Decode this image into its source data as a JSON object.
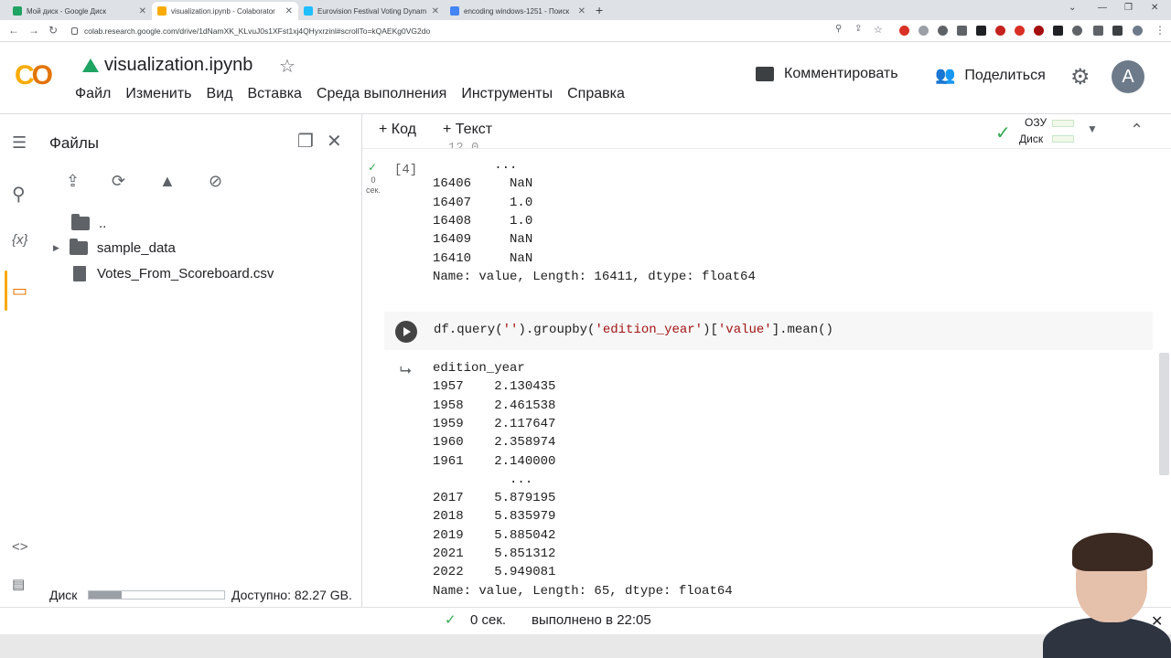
{
  "browser": {
    "tabs": [
      {
        "title": "Мой диск - Google Диск",
        "color": "#1fa463"
      },
      {
        "title": "visualization.ipynb - Colaborator",
        "color": "#f9ab00",
        "active": true
      },
      {
        "title": "Eurovision Festival Voting Dynam",
        "color": "#20beff"
      },
      {
        "title": "encoding windows-1251 - Поиск",
        "color": "#4285f4"
      }
    ],
    "url": "colab.research.google.com/drive/1dNamXK_KLvuJ0s1XFst1xj4QHyxrzinl#scrollTo=kQAEKg0VG2do"
  },
  "header": {
    "logo": "CO",
    "notebook_title": "visualization.ipynb",
    "menu": [
      "Файл",
      "Изменить",
      "Вид",
      "Вставка",
      "Среда выполнения",
      "Инструменты",
      "Справка"
    ],
    "comment_label": "Комментировать",
    "share_label": "Поделиться",
    "avatar_letter": "A"
  },
  "files_panel": {
    "title": "Файлы",
    "tree": [
      {
        "name": "..",
        "kind": "parent"
      },
      {
        "name": "sample_data",
        "kind": "folder"
      },
      {
        "name": "Votes_From_Scoreboard.csv",
        "kind": "file"
      }
    ],
    "disk_label": "Диск",
    "disk_free": "Доступно: 82.27 GB.",
    "disk_used_fraction": 0.24
  },
  "toolbar": {
    "add_code": "+ Код",
    "add_text": "+ Текст",
    "ram_label": "ОЗУ",
    "disk_label": "Диск"
  },
  "cell1": {
    "exec_count": "[4]",
    "status_time": "0\nсек.",
    "output": [
      "        ...",
      "16406     NaN",
      "16407     1.0",
      "16408     1.0",
      "16409     NaN",
      "16410     NaN",
      "Name: value, Length: 16411, dtype: float64"
    ]
  },
  "cell2": {
    "code_parts": [
      "df.query(",
      "''",
      ").groupby(",
      "'edition_year'",
      ")[",
      "'value'",
      "].mean()"
    ],
    "output": [
      "edition_year",
      "1957    2.130435",
      "1958    2.461538",
      "1959    2.117647",
      "1960    2.358974",
      "1961    2.140000",
      "          ...",
      "2017    5.879195",
      "2018    5.835979",
      "2019    5.885042",
      "2021    5.851312",
      "2022    5.949081",
      "Name: value, Length: 65, dtype: float64"
    ]
  },
  "statusbar": {
    "time": "0 сек.",
    "done": "выполнено в 22:05"
  }
}
